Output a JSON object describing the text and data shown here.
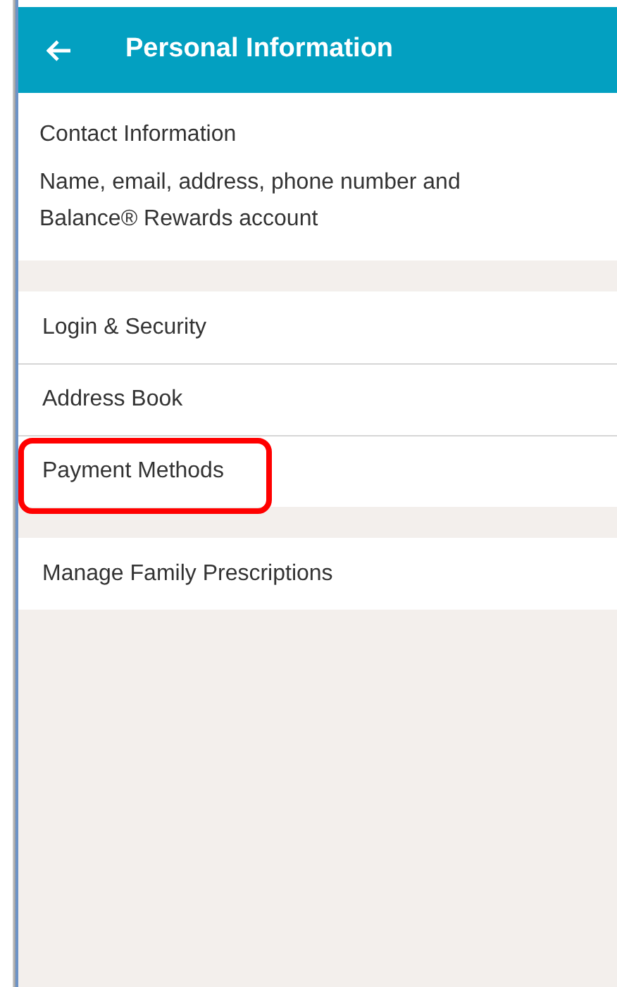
{
  "header": {
    "title": "Personal Information"
  },
  "sections": [
    {
      "items": [
        {
          "kind": "detail",
          "label": "Contact Information",
          "subtitle": "Name, email, address, phone number and Balance® Rewards account",
          "highlighted": false
        }
      ]
    },
    {
      "items": [
        {
          "kind": "link",
          "label": "Login & Security",
          "highlighted": false
        },
        {
          "kind": "link",
          "label": "Address Book",
          "highlighted": false
        },
        {
          "kind": "link",
          "label": "Payment Methods",
          "highlighted": true
        }
      ]
    },
    {
      "items": [
        {
          "kind": "link",
          "label": "Manage Family Prescriptions",
          "highlighted": false
        }
      ]
    }
  ]
}
